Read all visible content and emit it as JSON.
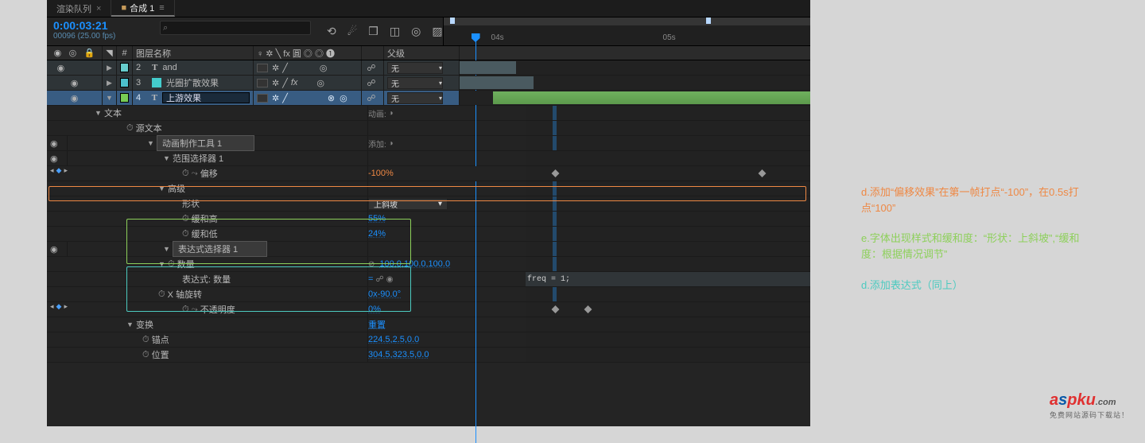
{
  "tabs": {
    "renderQueue": "渲染队列",
    "comp": "合成 1"
  },
  "time": {
    "code": "0:00:03:21",
    "frames": "00096 (25.00 fps)"
  },
  "headers": {
    "index": "#",
    "layerName": "图层名称",
    "switches": "♀ ✲ ╲ fx 圓 ◎ ◎ ❶",
    "parent": "父级"
  },
  "ruler": {
    "t1": "04s",
    "t2": "05s"
  },
  "parentNone": "无",
  "layers": {
    "l2": {
      "idx": "2",
      "name": "and"
    },
    "l3": {
      "idx": "3",
      "name": "光圈扩散效果"
    },
    "l4": {
      "idx": "4",
      "name": "上游效果"
    }
  },
  "props": {
    "text": "文本",
    "textAction": "动画:",
    "sourceText": "源文本",
    "animator": "动画制作工具 1",
    "animatorAction": "添加:",
    "rangeSelector": "范围选择器 1",
    "offset": "偏移",
    "offsetVal": "-100%",
    "advanced": "高级",
    "shape": "形状",
    "shapeVal": "上斜坡",
    "easeHigh": "缓和高",
    "easeHighVal": "55%",
    "easeLow": "缓和低",
    "easeLowVal": "24%",
    "exprSelector": "表达式选择器 1",
    "amount": "数量",
    "amountVal": "100.0,100.0,100.0",
    "exprAmount": "表达式: 数量",
    "xrot": "X 轴旋转",
    "xrotVal": "0x-90.0°",
    "opacity": "不透明度",
    "opacityVal": "0%",
    "transform": "变换",
    "transformAction": "重置",
    "anchor": "锚点",
    "anchorVal": "224.5,2.5,0.0",
    "position": "位置",
    "positionVal": "304.5,323.5,0.0",
    "exprCode": "freq = 1;"
  },
  "annotations": {
    "d1": "d.添加“偏移效果”在第一帧打点“-100”，在0.5s打点“100”",
    "e": "e.字体出现样式和缓和度：“形状：上斜坡”,“缓和度：根据情况调节”",
    "d2": "d.添加表达式（同上）"
  },
  "logo": {
    "text": "aspku",
    "dot": ".com",
    "sub": "免费网站源码下载站！"
  }
}
